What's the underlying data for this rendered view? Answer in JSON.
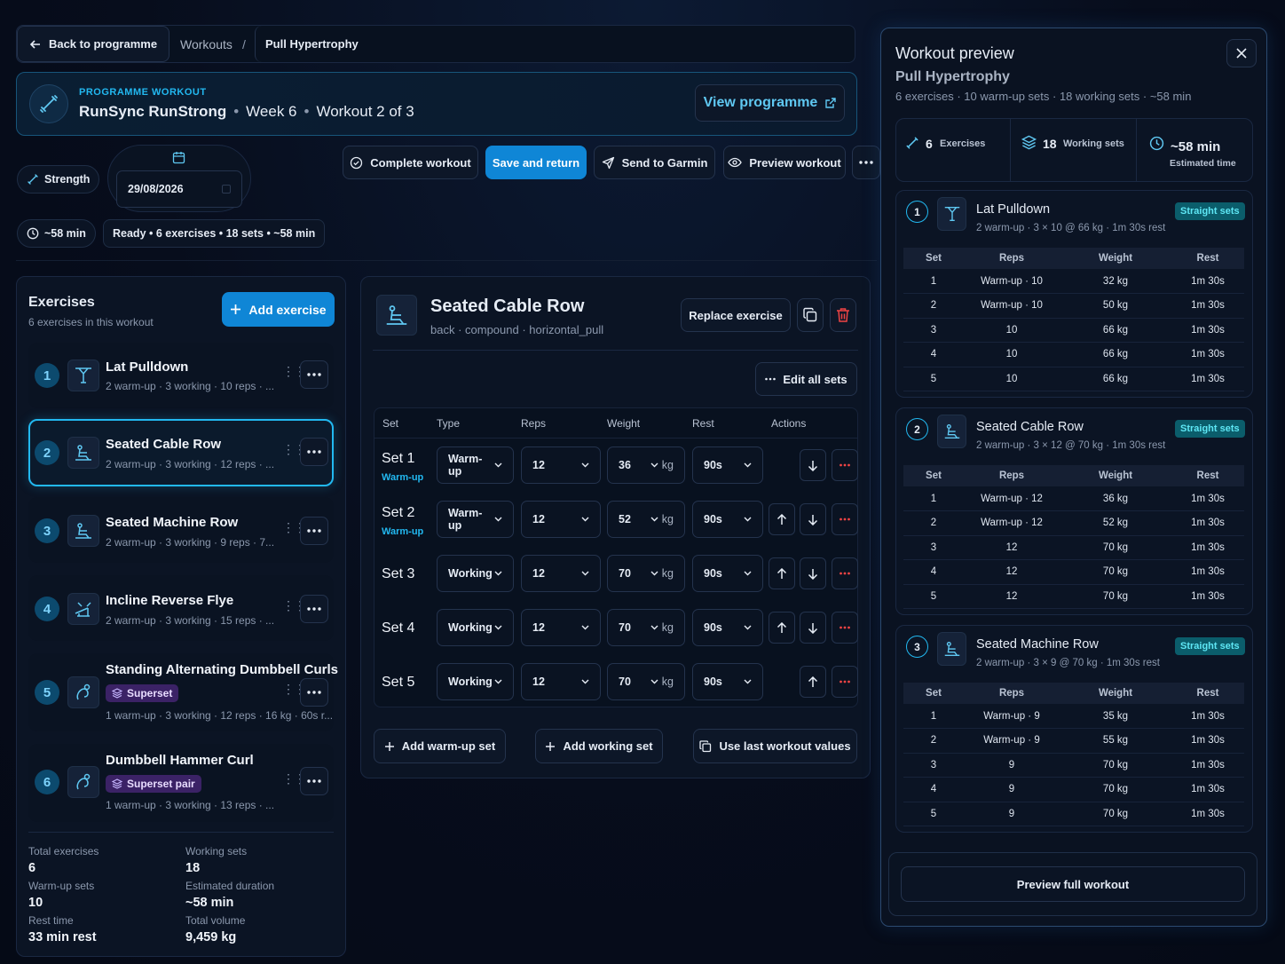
{
  "breadcrumb": {
    "back": "Back to programme",
    "workouts": "Workouts",
    "sep": "/",
    "current": "Pull Hypertrophy"
  },
  "programme": {
    "eyebrow": "PROGRAMME WORKOUT",
    "name": "RunSync RunStrong",
    "dot": "•",
    "week": "Week 6",
    "workout": "Workout 2 of 3",
    "view_button": "View programme"
  },
  "meta": {
    "type": "Strength",
    "date": "29/08/2026",
    "duration": "~58 min",
    "status": "Ready • 6 exercises • 18 sets • ~58 min"
  },
  "toolbar": {
    "complete": "Complete workout",
    "save": "Save and return",
    "garmin": "Send to Garmin",
    "preview": "Preview workout"
  },
  "exercises_panel": {
    "title": "Exercises",
    "subtitle": "6 exercises in this workout",
    "add": "Add exercise",
    "items": [
      {
        "num": "1",
        "name": "Lat Pulldown",
        "sub": "2 warm-up · 3 working · 10 reps · ..."
      },
      {
        "num": "2",
        "name": "Seated Cable Row",
        "sub": "2 warm-up · 3 working · 12 reps · ..."
      },
      {
        "num": "3",
        "name": "Seated Machine Row",
        "sub": "2 warm-up · 3 working · 9 reps · 7..."
      },
      {
        "num": "4",
        "name": "Incline Reverse Flye",
        "sub": "2 warm-up · 3 working · 15 reps · ..."
      },
      {
        "num": "5",
        "name": "Standing Alternating Dumbbell Curls",
        "badge": "Superset",
        "sub": "1 warm-up · 3 working · 12 reps · 16 kg · 60s r..."
      },
      {
        "num": "6",
        "name": "Dumbbell Hammer Curl",
        "badge": "Superset pair",
        "sub": "1 warm-up · 3 working · 13 reps · ..."
      }
    ],
    "stats": {
      "total_exercises_label": "Total exercises",
      "total_exercises": "6",
      "working_sets_label": "Working sets",
      "working_sets": "18",
      "warmup_sets_label": "Warm-up sets",
      "warmup_sets": "10",
      "duration_label": "Estimated duration",
      "duration": "~58 min",
      "rest_label": "Rest time",
      "rest": "33 min rest",
      "volume_label": "Total volume",
      "volume": "9,459 kg"
    }
  },
  "editor": {
    "title": "Seated Cable Row",
    "tags": "back · compound · horizontal_pull",
    "replace": "Replace exercise",
    "edit_all": "Edit all sets",
    "headers": {
      "set": "Set",
      "type": "Type",
      "reps": "Reps",
      "weight": "Weight",
      "rest": "Rest",
      "actions": "Actions"
    },
    "unit": "kg",
    "sets": [
      {
        "label": "Set 1",
        "tag": "Warm-up",
        "type": "Warm-up",
        "reps": "12",
        "weight": "36",
        "rest": "90s"
      },
      {
        "label": "Set 2",
        "tag": "Warm-up",
        "type": "Warm-up",
        "reps": "12",
        "weight": "52",
        "rest": "90s"
      },
      {
        "label": "Set 3",
        "type": "Working",
        "reps": "12",
        "weight": "70",
        "rest": "90s"
      },
      {
        "label": "Set 4",
        "type": "Working",
        "reps": "12",
        "weight": "70",
        "rest": "90s"
      },
      {
        "label": "Set 5",
        "type": "Working",
        "reps": "12",
        "weight": "70",
        "rest": "90s"
      }
    ],
    "add_warmup": "Add warm-up set",
    "add_working": "Add working set",
    "use_last": "Use last workout values"
  },
  "preview": {
    "title": "Workout preview",
    "name": "Pull Hypertrophy",
    "summary": "6 exercises · 10 warm-up sets · 18 working sets · ~58 min",
    "stats": {
      "exercises_n": "6",
      "exercises_l": "Exercises",
      "sets_n": "18",
      "sets_l": "Working sets",
      "time_n": "~58 min",
      "time_l": "Estimated time"
    },
    "table_headers": {
      "set": "Set",
      "reps": "Reps",
      "weight": "Weight",
      "rest": "Rest"
    },
    "exercises": [
      {
        "num": "1",
        "name": "Lat Pulldown",
        "tag": "Straight sets",
        "sub": "2 warm-up · 3 × 10 @ 66 kg · 1m 30s rest",
        "rows": [
          [
            "1",
            "Warm-up · 10",
            "32 kg",
            "1m 30s"
          ],
          [
            "2",
            "Warm-up · 10",
            "50 kg",
            "1m 30s"
          ],
          [
            "3",
            "10",
            "66 kg",
            "1m 30s"
          ],
          [
            "4",
            "10",
            "66 kg",
            "1m 30s"
          ],
          [
            "5",
            "10",
            "66 kg",
            "1m 30s"
          ]
        ]
      },
      {
        "num": "2",
        "name": "Seated Cable Row",
        "tag": "Straight sets",
        "sub": "2 warm-up · 3 × 12 @ 70 kg · 1m 30s rest",
        "rows": [
          [
            "1",
            "Warm-up · 12",
            "36 kg",
            "1m 30s"
          ],
          [
            "2",
            "Warm-up · 12",
            "52 kg",
            "1m 30s"
          ],
          [
            "3",
            "12",
            "70 kg",
            "1m 30s"
          ],
          [
            "4",
            "12",
            "70 kg",
            "1m 30s"
          ],
          [
            "5",
            "12",
            "70 kg",
            "1m 30s"
          ]
        ]
      },
      {
        "num": "3",
        "name": "Seated Machine Row",
        "tag": "Straight sets",
        "sub": "2 warm-up · 3 × 9 @ 70 kg · 1m 30s rest",
        "rows": [
          [
            "1",
            "Warm-up · 9",
            "35 kg",
            "1m 30s"
          ],
          [
            "2",
            "Warm-up · 9",
            "55 kg",
            "1m 30s"
          ],
          [
            "3",
            "9",
            "70 kg",
            "1m 30s"
          ],
          [
            "4",
            "9",
            "70 kg",
            "1m 30s"
          ],
          [
            "5",
            "9",
            "70 kg",
            "1m 30s"
          ]
        ]
      }
    ],
    "full_button": "Preview full workout"
  }
}
